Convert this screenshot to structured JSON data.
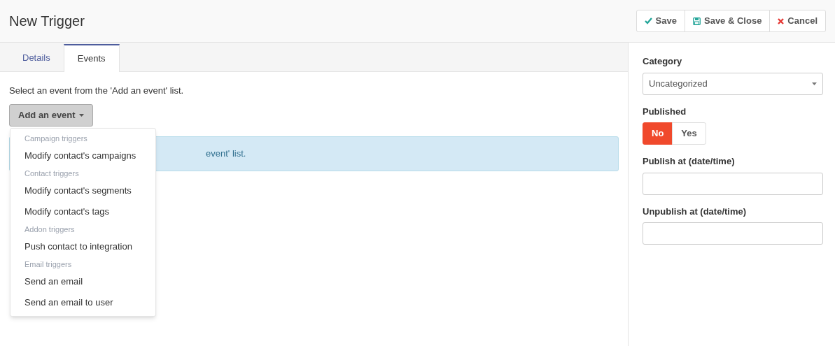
{
  "header": {
    "title": "New Trigger",
    "buttons": [
      {
        "kind": "save",
        "label": "Save"
      },
      {
        "kind": "save_close",
        "label": "Save & Close"
      },
      {
        "kind": "cancel",
        "label": "Cancel"
      }
    ]
  },
  "tabs": [
    {
      "label": "Details",
      "selected": false
    },
    {
      "label": "Events",
      "selected": true
    }
  ],
  "instruction": "Select an event from the 'Add an event' list.",
  "add_event_button": {
    "label": "Add an event",
    "expanded": true
  },
  "menu": [
    {
      "kind": "header",
      "label": "Campaign triggers"
    },
    {
      "kind": "item",
      "label": "Modify contact's campaigns"
    },
    {
      "kind": "header",
      "label": "Contact triggers"
    },
    {
      "kind": "item",
      "label": "Modify contact's segments"
    },
    {
      "kind": "item",
      "label": "Modify contact's tags"
    },
    {
      "kind": "header",
      "label": "Addon triggers"
    },
    {
      "kind": "item",
      "label": "Push contact to integration"
    },
    {
      "kind": "header",
      "label": "Email triggers"
    },
    {
      "kind": "item",
      "label": "Send an email"
    },
    {
      "kind": "item",
      "label": "Send an email to user"
    }
  ],
  "alert": {
    "text": "event' list."
  },
  "sidebar": {
    "category": {
      "label": "Category",
      "value": "Uncategorized"
    },
    "published": {
      "label": "Published",
      "options": [
        {
          "label": "No",
          "selected": true
        },
        {
          "label": "Yes",
          "selected": false
        }
      ]
    },
    "publish_at": {
      "label": "Publish at (date/time)"
    },
    "unpublish_at": {
      "label": "Unpublish at (date/time)"
    }
  }
}
